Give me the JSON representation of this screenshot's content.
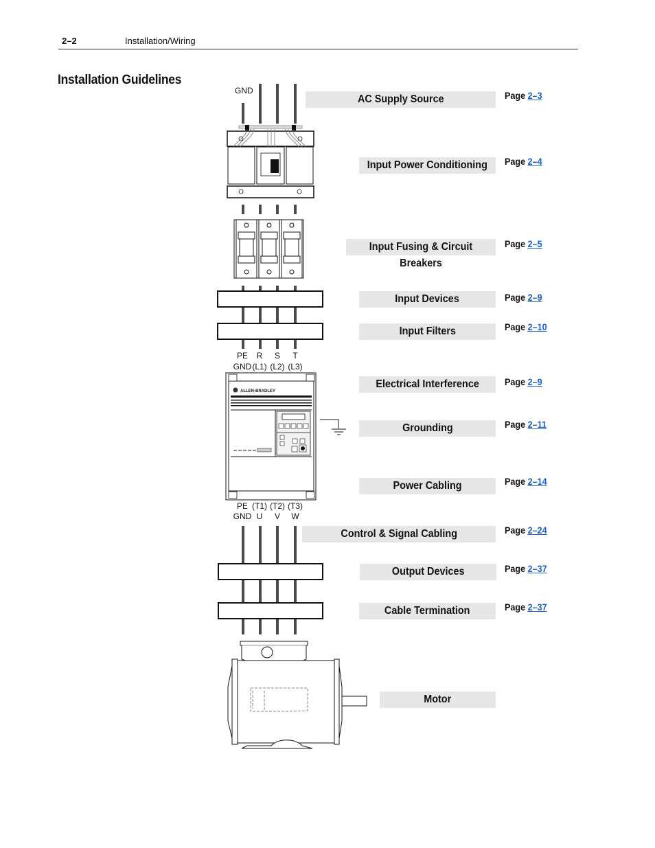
{
  "header": {
    "page_number": "2–2",
    "chapter": "Installation/Wiring"
  },
  "section_title": "Installation Guidelines",
  "diagram": {
    "gnd_label": "GND",
    "input_terminals": {
      "top": [
        "PE",
        "R",
        "S",
        "T"
      ],
      "bottom": [
        "GND",
        "(L1)",
        "(L2)",
        "(L3)"
      ]
    },
    "output_terminals": {
      "top": [
        "PE",
        "(T1)",
        "(T2)",
        "(T3)"
      ],
      "bottom": [
        "GND",
        "U",
        "V",
        "W"
      ]
    },
    "drive_brand": "ALLEN-BRADLEY"
  },
  "page_word": "Page",
  "guidelines": [
    {
      "label": "AC Supply Source",
      "page": "2–3"
    },
    {
      "label": "Input Power Conditioning",
      "page": "2–4"
    },
    {
      "label": "Input Fusing & Circuit Breakers",
      "page": "2–5"
    },
    {
      "label": "Input Devices",
      "page": "2–9"
    },
    {
      "label": "Input Filters",
      "page": "2–10"
    },
    {
      "label": "Electrical Interference",
      "page": "2–9"
    },
    {
      "label": "Grounding",
      "page": "2–11"
    },
    {
      "label": "Power Cabling",
      "page": "2–14"
    },
    {
      "label": "Control & Signal Cabling",
      "page": "2–24"
    },
    {
      "label": "Output Devices",
      "page": "2–37"
    },
    {
      "label": "Cable Termination",
      "page": "2–37"
    },
    {
      "label": "Motor",
      "page": ""
    }
  ]
}
